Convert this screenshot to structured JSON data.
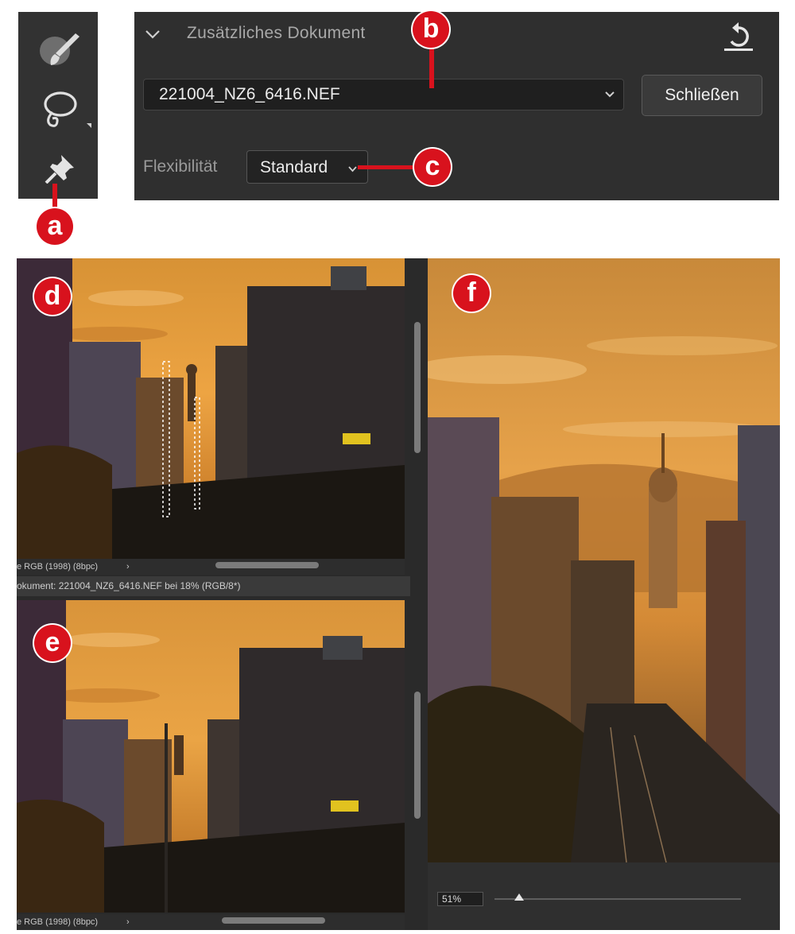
{
  "panel": {
    "title": "Zusätzliches Dokument",
    "document_select": {
      "value": "221004_NZ6_6416.NEF"
    },
    "close_label": "Schließen",
    "flex_label": "Flexibilität",
    "flex_select": {
      "value": "Standard"
    }
  },
  "callouts": {
    "a": "a",
    "b": "b",
    "c": "c",
    "d": "d",
    "e": "e",
    "f": "f"
  },
  "workspace": {
    "top_status": "e RGB (1998) (8bpc)",
    "doc_tab": "okument: 221004_NZ6_6416.NEF bei 18% (RGB/8*)",
    "bottom_status": "e RGB (1998) (8bpc)",
    "status_chevron": "›",
    "zoom": {
      "value": "51%",
      "level": 0.1
    }
  },
  "colors": {
    "callout": "#d8121d",
    "panel": "#2f2f2f",
    "toolbar": "#323232"
  },
  "icons": [
    "brush-icon",
    "lasso-icon",
    "pin-icon",
    "chevron-down-icon",
    "reset-icon"
  ]
}
